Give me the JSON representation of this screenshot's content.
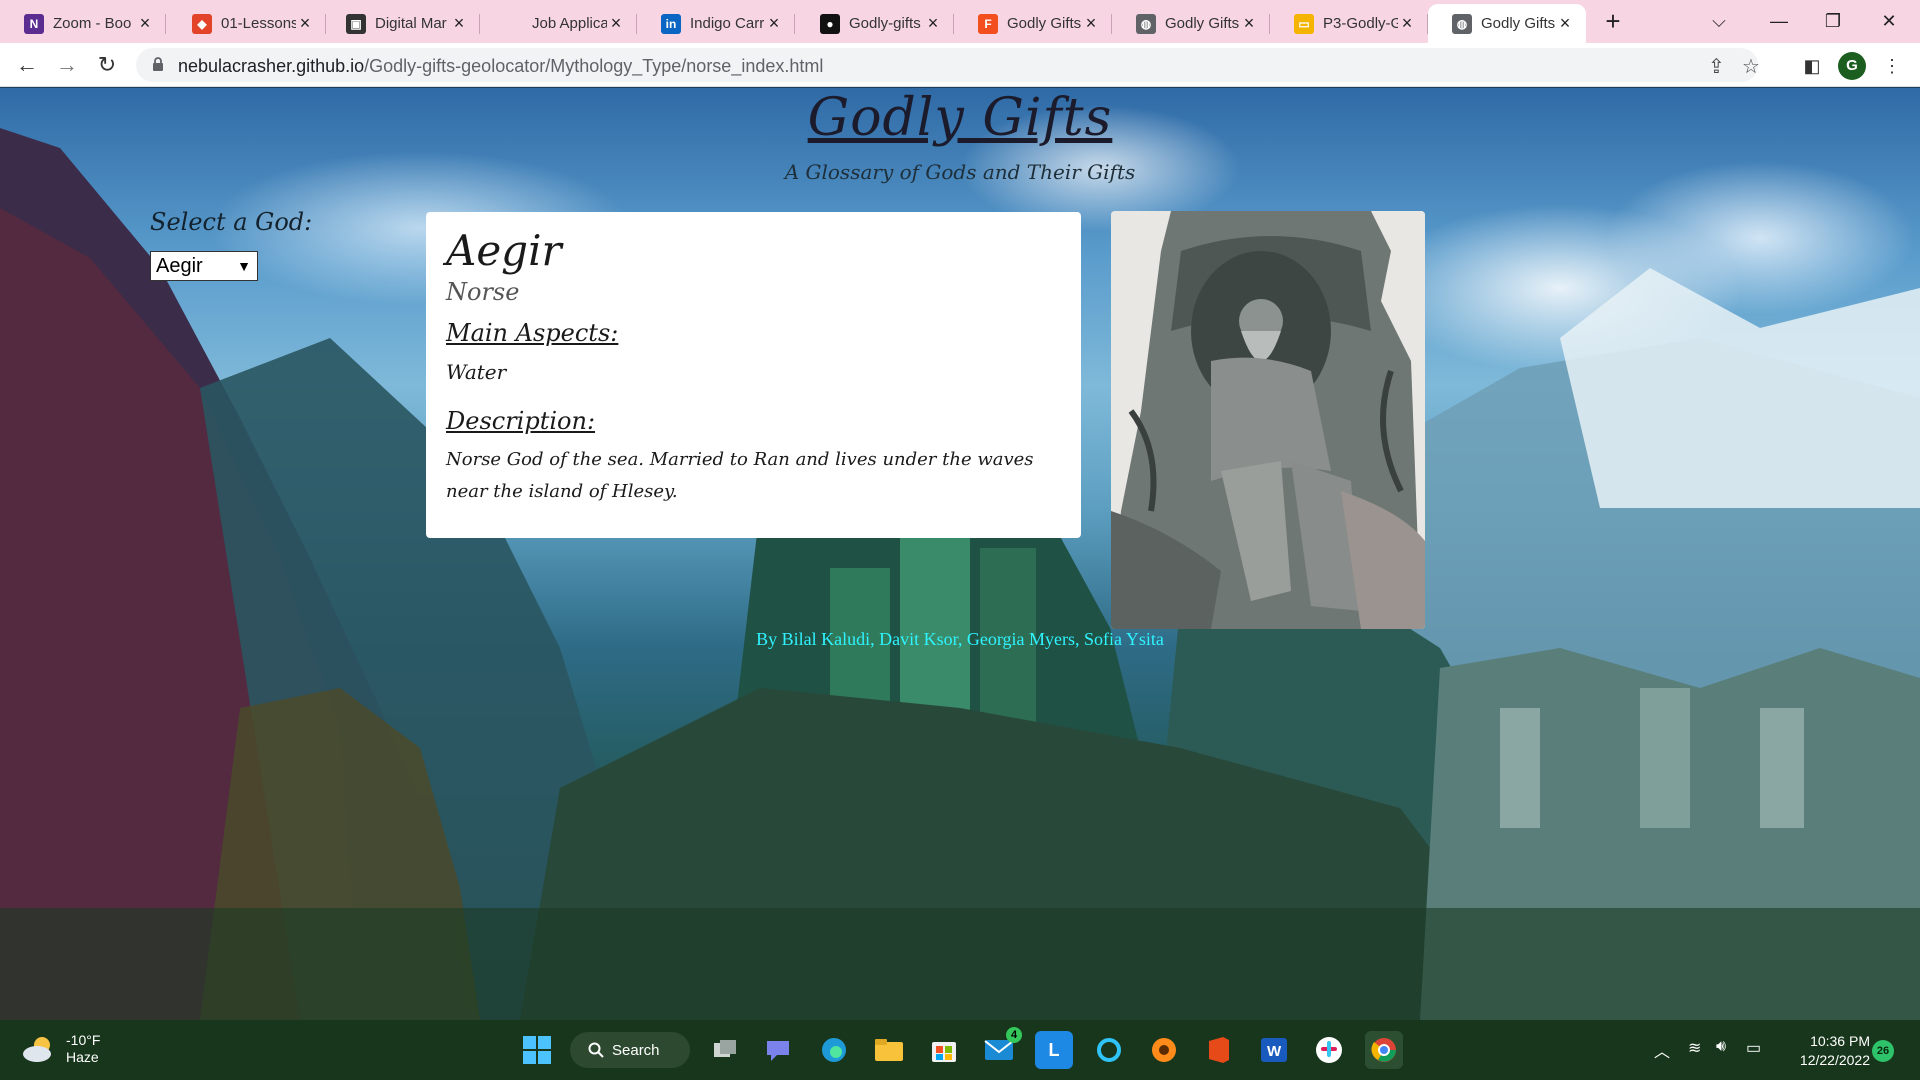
{
  "browser": {
    "tabs": [
      {
        "title": "Zoom - Boo",
        "icon": "onenote-icon",
        "color": "#5c2d91",
        "glyph": "N"
      },
      {
        "title": "01-Lessons",
        "icon": "gitlab-icon",
        "color": "#e24329",
        "glyph": "◆"
      },
      {
        "title": "Digital Mar",
        "icon": "ebook-icon",
        "color": "#333333",
        "glyph": "▣"
      },
      {
        "title": "Job Applica",
        "icon": "",
        "color": "",
        "glyph": ""
      },
      {
        "title": "Indigo Carr",
        "icon": "linkedin-icon",
        "color": "#0a66c2",
        "glyph": "in"
      },
      {
        "title": "Godly-gifts",
        "icon": "github-icon",
        "color": "#111111",
        "glyph": "●"
      },
      {
        "title": "Godly Gifts",
        "icon": "figma-icon",
        "color": "#f24e1e",
        "glyph": "F"
      },
      {
        "title": "Godly Gifts",
        "icon": "globe-icon",
        "color": "#5f6368",
        "glyph": "◍"
      },
      {
        "title": "P3-Godly-G",
        "icon": "slides-icon",
        "color": "#f4b400",
        "glyph": "▭"
      },
      {
        "title": "Godly Gifts",
        "icon": "globe-icon",
        "color": "#5f6368",
        "glyph": "◍"
      }
    ],
    "active_tab_index": 9,
    "url_host": "nebulacrasher.github.io",
    "url_path": "/Godly-gifts-geolocator/Mythology_Type/norse_index.html",
    "profile_initial": "G"
  },
  "page": {
    "title": "Godly Gifts",
    "subtitle": "A Glossary of Gods and Their Gifts",
    "select_label": "Select a God:",
    "selected_god": "Aegir",
    "card": {
      "name": "Aegir",
      "mythology": "Norse",
      "aspects_heading": "Main Aspects:",
      "aspects": "Water",
      "description_heading": "Description:",
      "description": "Norse God of the sea. Married to Ran and lives under the waves near the island of Hlesey."
    },
    "credits": "By Bilal Kaludi, Davit Ksor, Georgia Myers, Sofia Ysita",
    "credits_color": "#2ff4ff"
  },
  "taskbar": {
    "weather_temp": "-10°F",
    "weather_desc": "Haze",
    "search_label": "Search",
    "mail_badge": "4",
    "time": "10:36 PM",
    "date": "12/22/2022",
    "notifications": "26"
  }
}
